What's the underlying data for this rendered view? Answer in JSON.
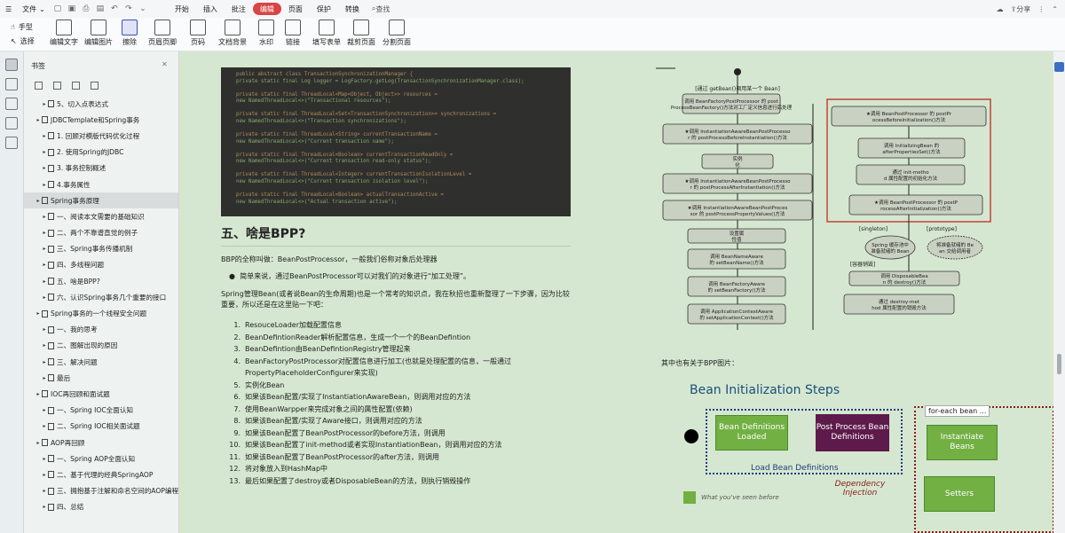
{
  "menu": {
    "file": "文件",
    "items": [
      "开始",
      "插入",
      "批注",
      "编辑",
      "页面",
      "保护",
      "转换"
    ],
    "active": "编辑",
    "search": "查找",
    "share": "分享"
  },
  "toolbar": {
    "hand": "手型",
    "select": "选择",
    "buttons": [
      "编辑文字",
      "编辑图片",
      "擦除",
      "页眉页脚",
      "页码",
      "文档背景",
      "水印",
      "链接",
      "填写表单",
      "裁剪页面",
      "分割页面"
    ]
  },
  "sidebar": {
    "title": "书签",
    "items": [
      {
        "level": 2,
        "text": "5、切入点表达式"
      },
      {
        "level": 1,
        "text": "JDBCTemplate和Spring事务"
      },
      {
        "level": 2,
        "text": "1. 回顾对模版代码优化过程"
      },
      {
        "level": 2,
        "text": "2. 使用Spring的JDBC"
      },
      {
        "level": 2,
        "text": "3. 事务控制概述"
      },
      {
        "level": 2,
        "text": "4.事务属性"
      },
      {
        "level": 1,
        "text": "Spring事务原理",
        "selected": true
      },
      {
        "level": 2,
        "text": "一、阅读本文需要的基础知识"
      },
      {
        "level": 2,
        "text": "二、两个不靠谱直觉的例子"
      },
      {
        "level": 2,
        "text": "三、Spring事务传播机制"
      },
      {
        "level": 2,
        "text": "四、多线程问题"
      },
      {
        "level": 2,
        "text": "五、啥是BPP?"
      },
      {
        "level": 2,
        "text": "六、认识Spring事务几个重要的接口"
      },
      {
        "level": 1,
        "text": "Spring事务的一个线程安全问题"
      },
      {
        "level": 2,
        "text": "一、我的思考"
      },
      {
        "level": 2,
        "text": "二、图解出现的原因"
      },
      {
        "level": 2,
        "text": "三、解决问题"
      },
      {
        "level": 2,
        "text": "最后"
      },
      {
        "level": 1,
        "text": "IOC再回顾和面试题"
      },
      {
        "level": 2,
        "text": "一、Spring IOC全面认知"
      },
      {
        "level": 2,
        "text": "二、Spring IOC相关面试题"
      },
      {
        "level": 1,
        "text": "AOP再回顾"
      },
      {
        "level": 2,
        "text": "一、Spring AOP全面认知"
      },
      {
        "level": 2,
        "text": "二、基于代理的经典SpringAOP"
      },
      {
        "level": 2,
        "text": "三、拥抱基于注解和命名空间的AOP编程"
      },
      {
        "level": 2,
        "text": "四、总结"
      }
    ]
  },
  "doc": {
    "code_lines": [
      "public abstract class TransactionSynchronizationManager {",
      "private static final Log logger = LogFactory.getLog(TransactionSynchronizationManager.class);",
      "private static final ThreadLocal<Map<Object, Object>> resources =",
      "new NamedThreadLocal<>(\"Transactional resources\");",
      "private static final ThreadLocal<Set<TransactionSynchronization>> synchronizations =",
      "new NamedThreadLocal<>(\"Transaction synchronizations\");",
      "private static final ThreadLocal<String> currentTransactionName =",
      "new NamedThreadLocal<>(\"Current transaction name\");",
      "private static final ThreadLocal<Boolean> currentTransactionReadOnly =",
      "new NamedThreadLocal<>(\"Current transaction read-only status\");",
      "private static final ThreadLocal<Integer> currentTransactionIsolationLevel =",
      "new NamedThreadLocal<>(\"Current transaction isolation level\");",
      "private static final ThreadLocal<Boolean> actualTransactionActive =",
      "new NamedThreadLocal<>(\"Actual transaction active\");"
    ],
    "heading": "五、啥是BPP?",
    "para1": "BBP的全称叫做：BeanPostProcessor，一般我们俗称对象后处理器",
    "bullet": "简单来说，通过BeanPostProcessor可以对我们的对象进行“加工处理”。",
    "para2": "Spring管理Bean(或者说Bean的生命周期)也是一个常考的知识点，我在秋招也重新整理了一下步骤，因为比较重要，所以还是在这里贴一下吧：",
    "steps": [
      "ResouceLoader加载配置信息",
      "BeanDefintionReader解析配置信息，生成一个一个的BeanDefintion",
      "BeanDefintion由BeanDefintionRegistry管理起来",
      "BeanFactoryPostProcessor对配置信息进行加工(也就是处理配置的信息，一般通过PropertyPlaceholderConfigurer来实现)",
      "实例化Bean",
      "如果该Bean配置/实现了InstantiationAwareBean，则调用对应的方法",
      "使用BeanWarpper来完成对象之间的属性配置(依赖)",
      "如果该Bean配置/实现了Aware接口，则调用对应的方法",
      "如果该Bean配置了BeanPostProcessor的before方法，则调用",
      "如果该Bean配置了init-method或者实现InstantiationBean，则调用对应的方法",
      "如果该Bean配置了BeanPostProcessor的after方法，则调用",
      "将对象放入到HashMap中",
      "最后如果配置了destroy或者DisposableBean的方法，则执行销毁操作"
    ],
    "caption": "其中也有关于BPP图片：",
    "fig1": {
      "top": "[通过 getBean()调用某一个 Bean]",
      "boxes": [
        "调用 BeanFactoryPostProcessor 的 postProcessBeanFactory()方法对工厂定义信息进行后处理",
        "★调用 InstantiationAwareBeanPostProcessor 的 postProcessBeforeInstantiation()方法",
        "实例化",
        "★调用 InstantiationAwareBeanPostProcessor 的 postProcessAfterInstantiation()方法",
        "★调用 InstantiationAwareBeanPostProcessor 的 postProcessPropertyValues()方法",
        "设置属性值",
        "调用 BeanNameAware 的 setBeanName()方法",
        "调用 BeanFactoryAware 的 setBeanFactory()方法",
        "调用 ApplicationContextAware 的 setApplicationContext()方法",
        "★调用 BeanPostProcessor 的 postProcessBeforeInitialization()方法",
        "调用 InitializingBean 的 afterPropertiesSet()方法",
        "通过 init-method 属性配置的初始化方法",
        "★调用 BeanPostProcessor 的 postProcessAfterInitialization()方法",
        "Spring 缓存池中准备就绪的 Bean",
        "将准备就绪的 Bean 交给调用者",
        "调用 DisposableBean 的 destroy()方法",
        "通过 destroy-method 属性配置的销毁方法"
      ],
      "labels": [
        "[singleton]",
        "[prototype]",
        "[容器销毁]"
      ]
    },
    "fig2": {
      "title": "Bean Initialization Steps",
      "box1": "Bean Definitions Loaded",
      "box2": "Post Process Bean Definitions",
      "box3": "Instantiate Beans",
      "box4": "Setters",
      "label1": "Load Bean Definitions",
      "label2": "for-each bean ...",
      "label3": "Dependency Injection",
      "legend": "What you've seen before"
    }
  },
  "colors": {
    "active_tab": "#d84545",
    "doc_bg": "#d5e7d0",
    "sidebar_bg": "#eef2f1"
  }
}
